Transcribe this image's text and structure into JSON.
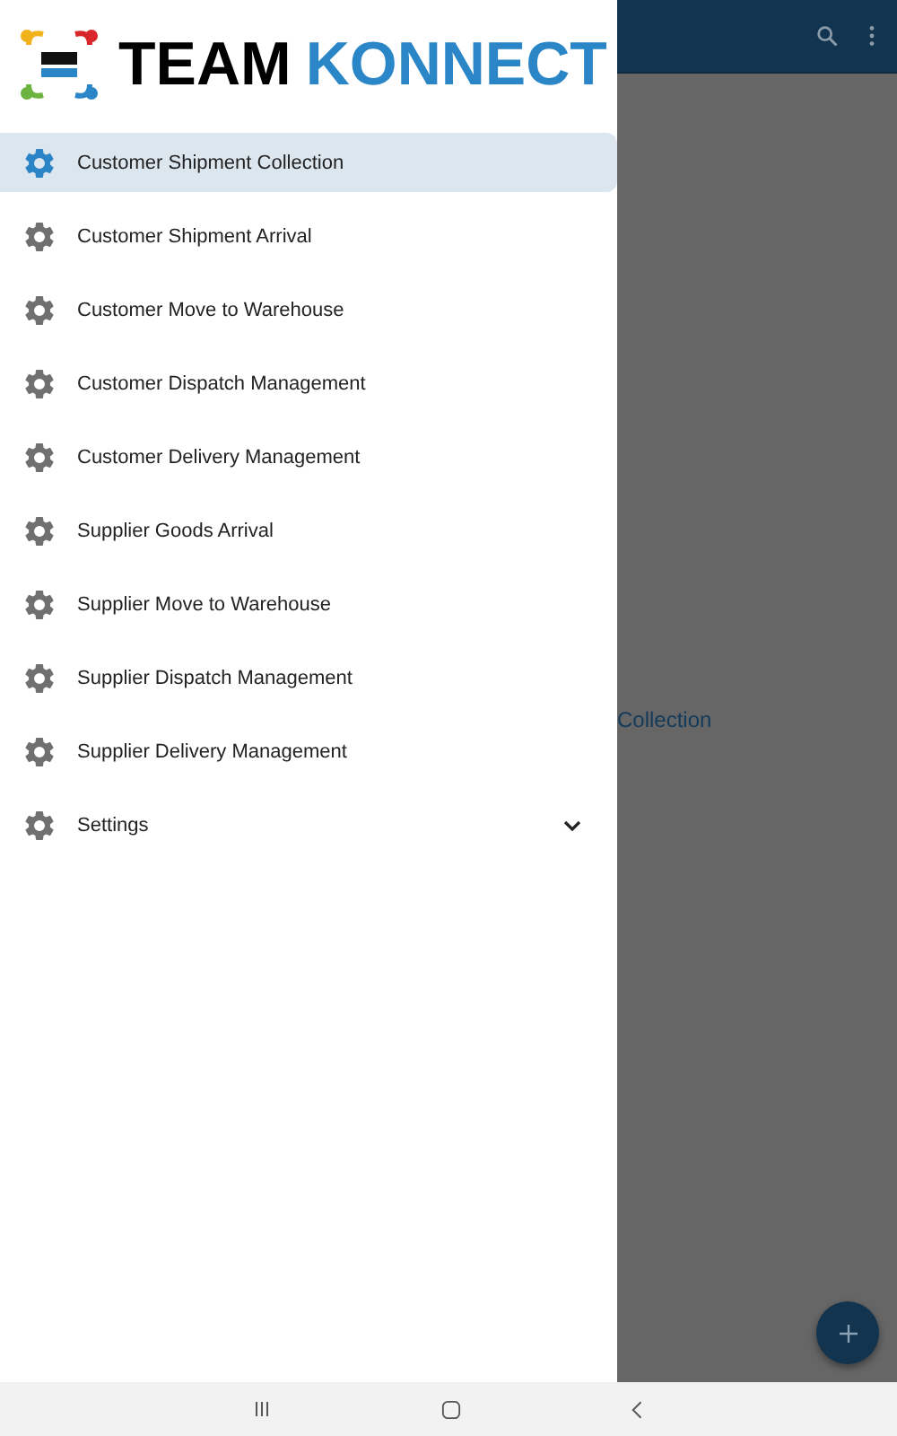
{
  "drawer": {
    "logo": {
      "word_1": "TEAM",
      "word_2": "KONNECT"
    },
    "items": [
      {
        "label": "Customer Shipment Collection",
        "selected": true,
        "kind": "link"
      },
      {
        "label": "Customer Shipment Arrival",
        "selected": false,
        "kind": "link"
      },
      {
        "label": "Customer Move to Warehouse",
        "selected": false,
        "kind": "link"
      },
      {
        "label": "Customer Dispatch Management",
        "selected": false,
        "kind": "link"
      },
      {
        "label": "Customer Delivery Management",
        "selected": false,
        "kind": "link"
      },
      {
        "label": "Supplier Goods Arrival",
        "selected": false,
        "kind": "link"
      },
      {
        "label": "Supplier Move to Warehouse",
        "selected": false,
        "kind": "link"
      },
      {
        "label": "Supplier Dispatch Management",
        "selected": false,
        "kind": "link"
      },
      {
        "label": "Supplier Delivery Management",
        "selected": false,
        "kind": "link"
      },
      {
        "label": "Settings",
        "selected": false,
        "kind": "group",
        "expanded": false
      }
    ]
  },
  "background": {
    "visible_text": "Collection"
  }
}
